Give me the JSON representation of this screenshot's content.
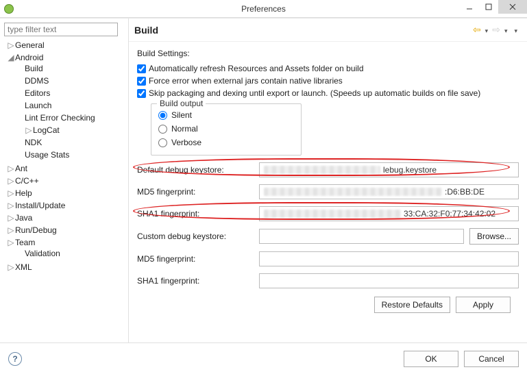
{
  "window": {
    "title": "Preferences"
  },
  "filter": {
    "placeholder": "type filter text"
  },
  "tree": {
    "general": "General",
    "android": "Android",
    "build": "Build",
    "ddms": "DDMS",
    "editors": "Editors",
    "launch": "Launch",
    "lint": "Lint Error Checking",
    "logcat": "LogCat",
    "ndk": "NDK",
    "usage": "Usage Stats",
    "ant": "Ant",
    "ccpp": "C/C++",
    "help": "Help",
    "install": "Install/Update",
    "java": "Java",
    "rundebug": "Run/Debug",
    "team": "Team",
    "validation": "Validation",
    "xml": "XML"
  },
  "page": {
    "title": "Build",
    "settings_label": "Build Settings:",
    "chk_refresh": "Automatically refresh Resources and Assets folder on build",
    "chk_force": "Force error when external jars contain native libraries",
    "chk_skip": "Skip packaging and dexing until export or launch. (Speeds up automatic builds on file save)",
    "group_title": "Build output",
    "radio_silent": "Silent",
    "radio_normal": "Normal",
    "radio_verbose": "Verbose",
    "lbl_def_keystore": "Default debug keystore:",
    "lbl_md5": "MD5 fingerprint:",
    "lbl_sha1": "SHA1 fingerprint:",
    "lbl_custom_keystore": "Custom debug keystore:",
    "val_def_keystore_suffix": "lebug.keystore",
    "val_md5_suffix": ":D6:BB:DE",
    "val_sha1_suffix": "33:CA:32:F0:77:34:42:02",
    "btn_browse": "Browse...",
    "btn_restore": "Restore Defaults",
    "btn_apply": "Apply"
  },
  "footer": {
    "ok": "OK",
    "cancel": "Cancel",
    "help": "?"
  }
}
